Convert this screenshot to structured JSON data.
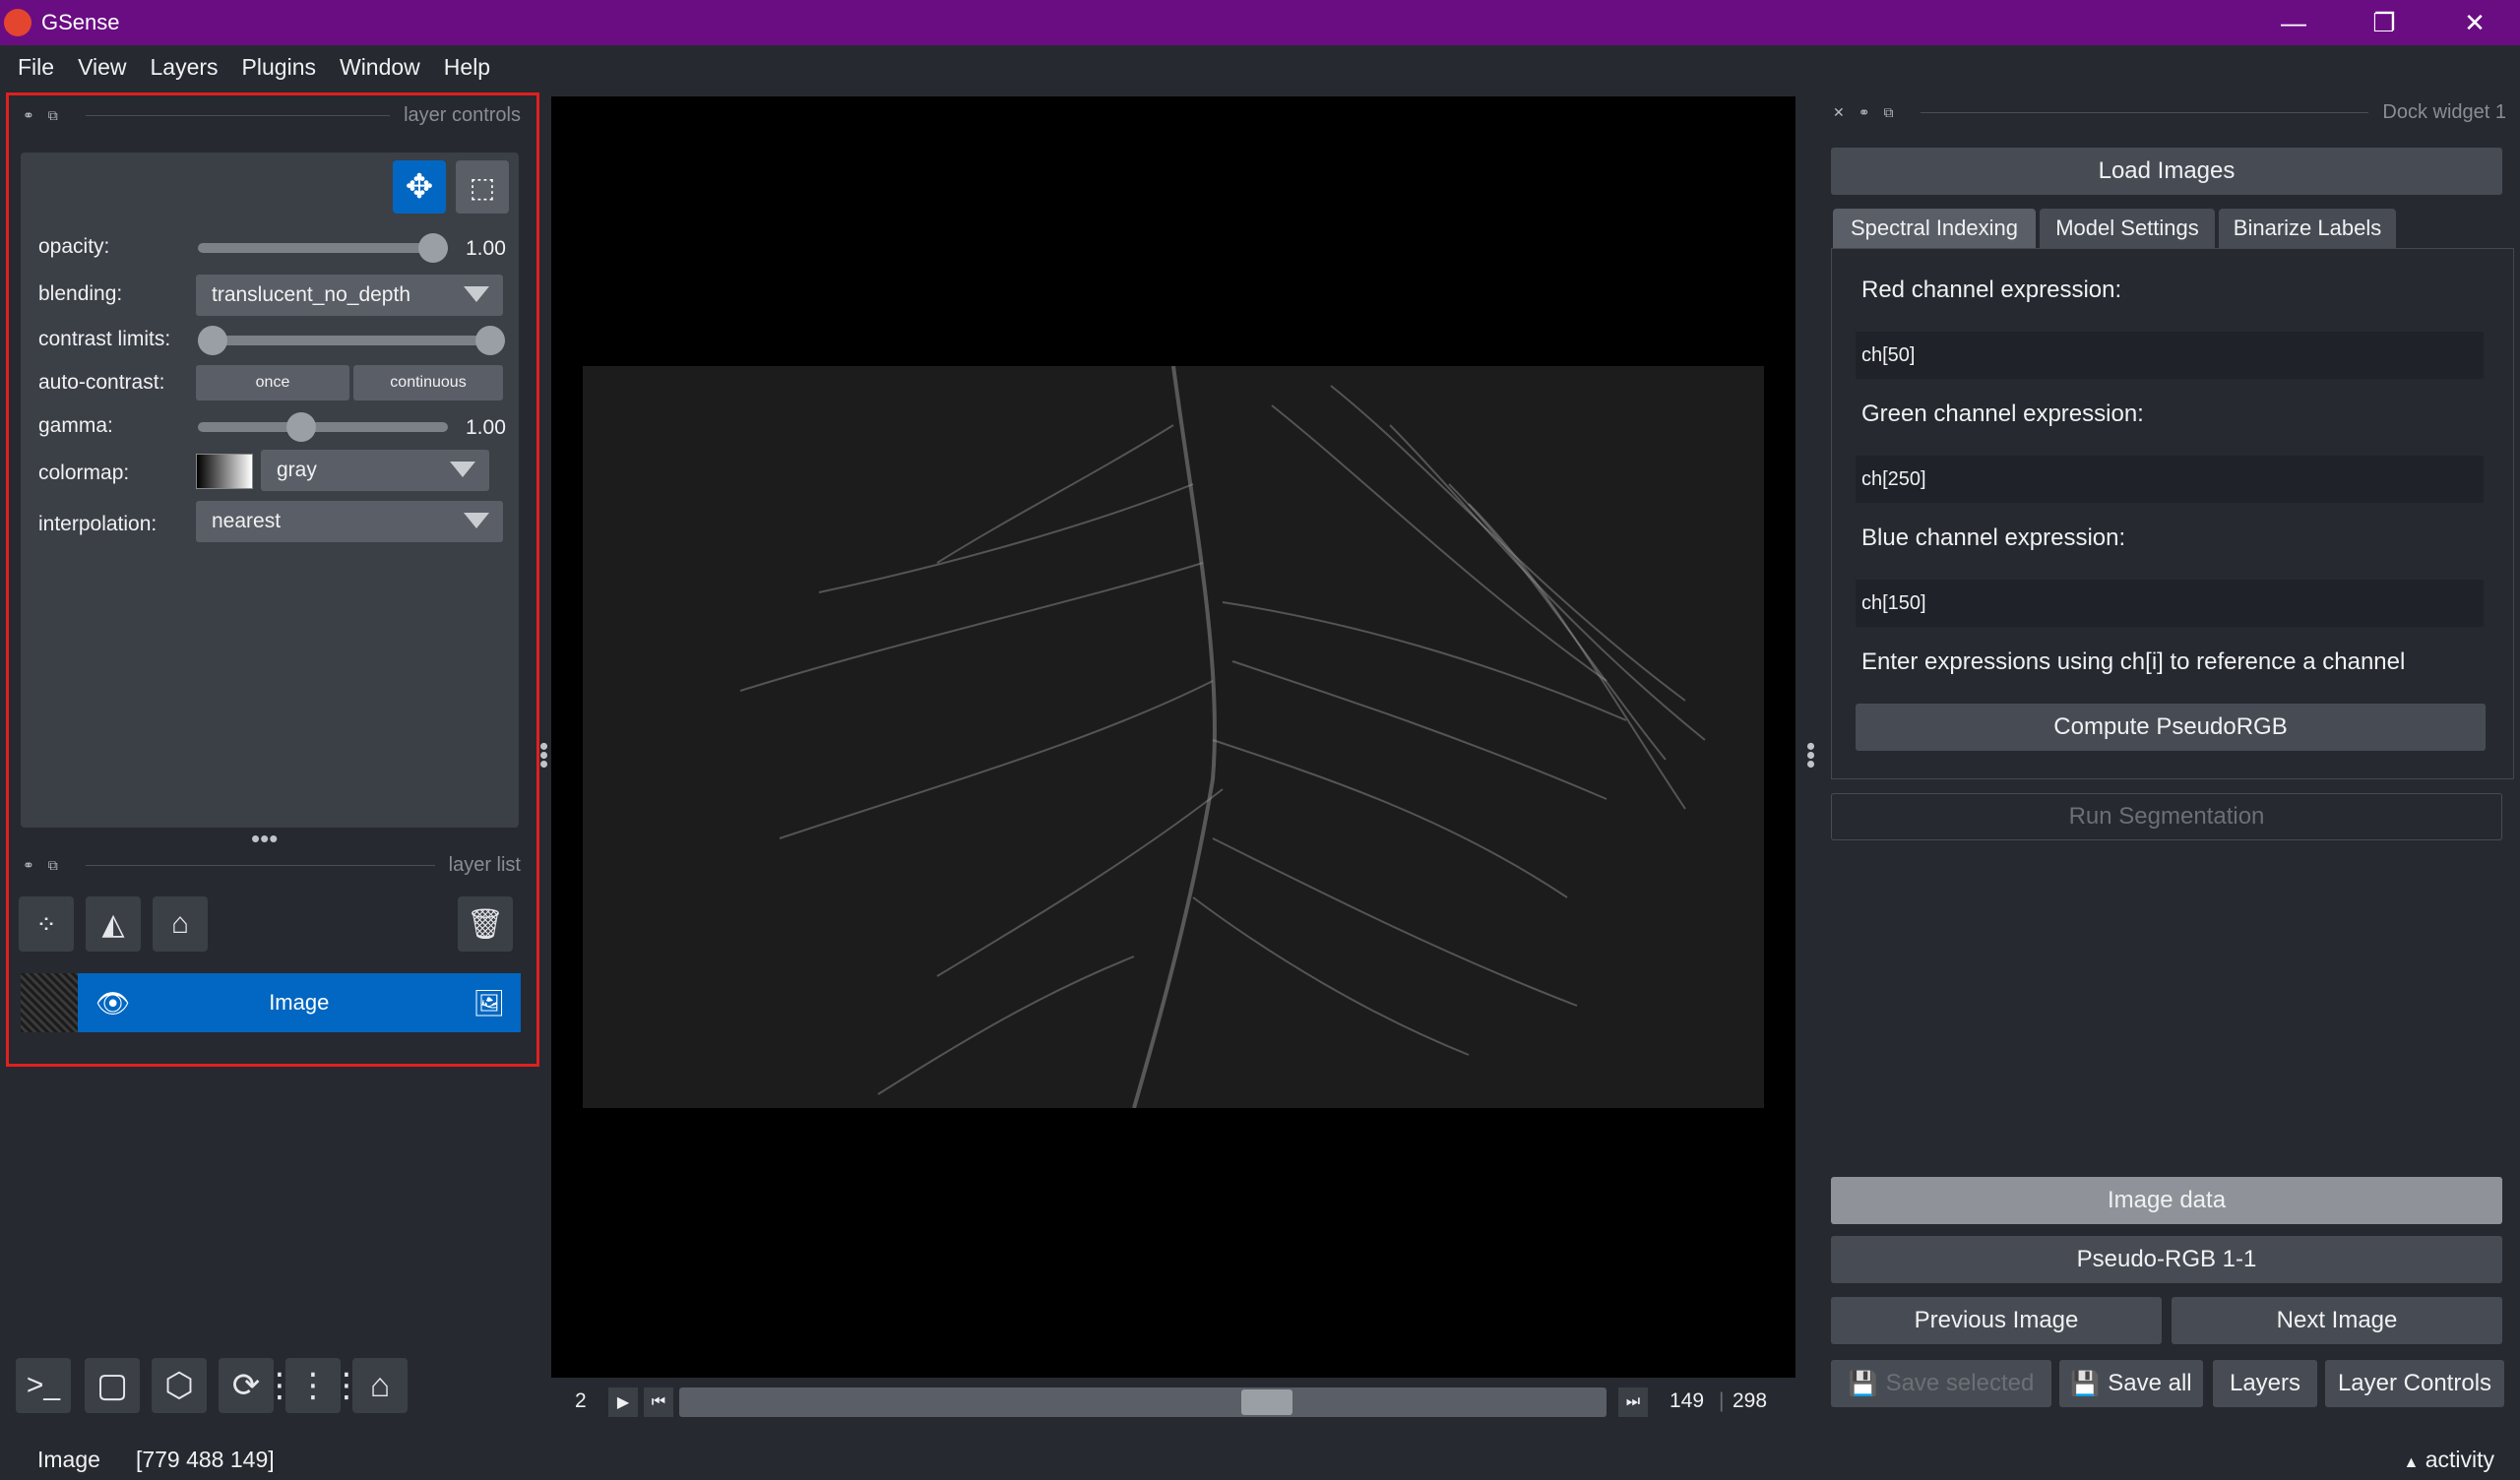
{
  "window": {
    "title": "GSense",
    "controls": [
      "—",
      "❐",
      "✕"
    ]
  },
  "menu": [
    "File",
    "View",
    "Layers",
    "Plugins",
    "Window",
    "Help"
  ],
  "layer_controls": {
    "header": "layer controls",
    "opacity_label": "opacity:",
    "opacity_value": "1.00",
    "opacity_level": 1.0,
    "blending_label": "blending:",
    "blending_value": "translucent_no_depth",
    "contrast_label": "contrast limits:",
    "contrast_range": [
      0.0,
      1.0
    ],
    "auto_contrast_label": "auto-contrast:",
    "auto_once": "once",
    "auto_continuous": "continuous",
    "gamma_label": "gamma:",
    "gamma_value": "1.00",
    "colormap_label": "colormap:",
    "colormap_value": "gray",
    "interpolation_label": "interpolation:",
    "interpolation_value": "nearest"
  },
  "layer_list": {
    "header": "layer list",
    "layers": [
      {
        "name": "Image",
        "visible": true
      }
    ]
  },
  "dims": {
    "axis_index": "2",
    "current": "149",
    "total": "298",
    "position_fraction": 0.5
  },
  "status": {
    "layer": "Image",
    "coords": "[779 488 149]",
    "activity": "activity"
  },
  "dock": {
    "header": "Dock widget 1",
    "load_images": "Load Images",
    "tabs": [
      "Spectral Indexing",
      "Model Settings",
      "Binarize Labels"
    ],
    "red_label": "Red channel expression:",
    "red_value": "ch[50]",
    "green_label": "Green channel expression:",
    "green_value": "ch[250]",
    "blue_label": "Blue channel expression:",
    "blue_value": "ch[150]",
    "hint": "Enter expressions using ch[i] to reference a channel",
    "compute": "Compute PseudoRGB",
    "run_segmentation": "Run Segmentation",
    "image_data": "Image data",
    "pseudo_rgb": "Pseudo-RGB 1-1",
    "previous": "Previous Image",
    "next": "Next Image",
    "save_selected": "Save selected",
    "save_all": "Save all",
    "layers": "Layers",
    "layer_controls": "Layer Controls"
  },
  "colors": {
    "titlebar": "#6a0d83",
    "accent": "#0167c2",
    "panel": "#3b3f46",
    "background": "#262930"
  }
}
